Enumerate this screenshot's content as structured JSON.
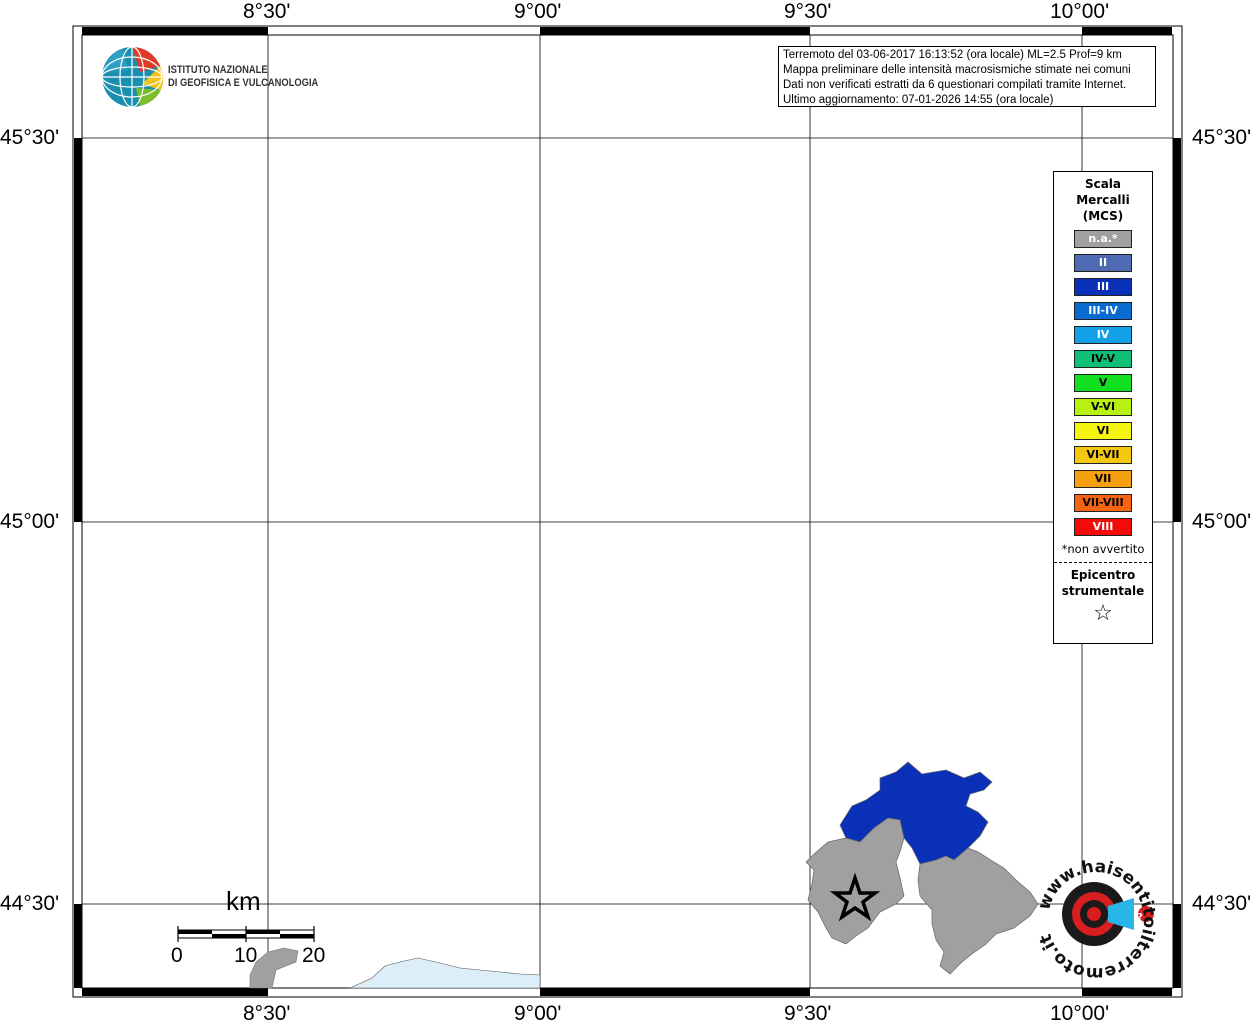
{
  "map": {
    "lon_ticks": [
      "8°30'",
      "9°00'",
      "9°30'",
      "10°00'"
    ],
    "lat_ticks": [
      "45°30'",
      "45°00'",
      "44°30'"
    ]
  },
  "logo": {
    "line1": "ISTITUTO NAZIONALE",
    "line2": "DI GEOFISICA E VULCANOLOGIA"
  },
  "info": {
    "line1": "Terremoto del 03-06-2017 16:13:52 (ora locale) ML=2.5 Prof=9 km",
    "line2": "Mappa preliminare delle intensità macrosismiche stimate nei comuni",
    "line3": "Dati non verificati estratti da 6 questionari compilati tramite Internet.",
    "line4": "Ultimo aggiornamento: 07-01-2026 14:55 (ora locale)"
  },
  "legend": {
    "title_line1": "Scala",
    "title_line2": "Mercalli",
    "title_line3": "(MCS)",
    "items": [
      {
        "label": "n.a.*",
        "color": "#a0a0a0",
        "text_color": "#ffffff"
      },
      {
        "label": "II",
        "color": "#4f6bb3",
        "text_color": "#ffffff"
      },
      {
        "label": "III",
        "color": "#0a30b8",
        "text_color": "#ffffff"
      },
      {
        "label": "III-IV",
        "color": "#0a6ad0",
        "text_color": "#ffffff"
      },
      {
        "label": "IV",
        "color": "#12a0e6",
        "text_color": "#ffffff"
      },
      {
        "label": "IV-V",
        "color": "#0fbf78",
        "text_color": "#000000"
      },
      {
        "label": "V",
        "color": "#10e020",
        "text_color": "#000000"
      },
      {
        "label": "V-VI",
        "color": "#b8f010",
        "text_color": "#000000"
      },
      {
        "label": "VI",
        "color": "#f5f510",
        "text_color": "#000000"
      },
      {
        "label": "VI-VII",
        "color": "#f5c810",
        "text_color": "#000000"
      },
      {
        "label": "VII",
        "color": "#f5a010",
        "text_color": "#000000"
      },
      {
        "label": "VII-VIII",
        "color": "#f56410",
        "text_color": "#000000"
      },
      {
        "label": "VIII",
        "color": "#f50a0a",
        "text_color": "#ffffff"
      }
    ],
    "note": "*non avvertito",
    "epicenter_line1": "Epicentro",
    "epicenter_line2": "strumentale",
    "epicenter_symbol": "☆"
  },
  "scale_bar": {
    "unit": "km",
    "ticks": [
      "0",
      "10",
      "20"
    ]
  },
  "watermark": {
    "text": "www.haisentitoilterremoto.it"
  },
  "colors": {
    "grid": "#000000",
    "intensity_III": "#0a30b8",
    "not_available": "#a0a0a0",
    "sea": "#dbeefa"
  }
}
